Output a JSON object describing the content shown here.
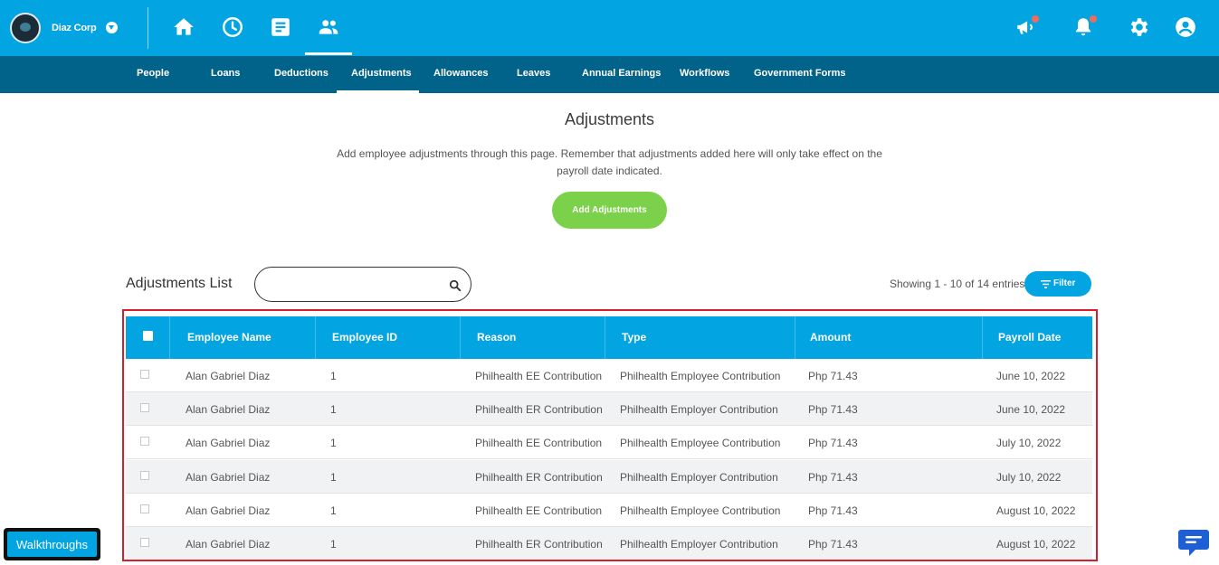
{
  "header": {
    "company": "Diaz Corp",
    "top_icons": [
      "home-icon",
      "clock-icon",
      "document-icon",
      "people-icon"
    ],
    "right_icons": [
      "megaphone-icon",
      "bell-icon",
      "gear-icon",
      "user-circle-icon"
    ]
  },
  "subnav": {
    "items": [
      "People",
      "Loans",
      "Deductions",
      "Adjustments",
      "Allowances",
      "Leaves",
      "Annual Earnings",
      "Workflows",
      "Government Forms"
    ],
    "active": "Adjustments"
  },
  "page": {
    "title": "Adjustments",
    "description": "Add employee adjustments through this page. Remember that adjustments added here will only take effect on the payroll date indicated.",
    "add_button": "Add Adjustments"
  },
  "list": {
    "title": "Adjustments List",
    "search_value": "",
    "showing": "Showing 1 - 10 of 14 entries",
    "filter_label": "Filter"
  },
  "table": {
    "headers": [
      "Employee Name",
      "Employee ID",
      "Reason",
      "Type",
      "Amount",
      "Payroll Date"
    ],
    "rows": [
      [
        "Alan Gabriel Diaz",
        "1",
        "Philhealth EE Contribution",
        "Philhealth Employee Contribution",
        "Php 71.43",
        "June 10, 2022"
      ],
      [
        "Alan Gabriel Diaz",
        "1",
        "Philhealth ER Contribution",
        "Philhealth Employer Contribution",
        "Php 71.43",
        "June 10, 2022"
      ],
      [
        "Alan Gabriel Diaz",
        "1",
        "Philhealth EE Contribution",
        "Philhealth Employee Contribution",
        "Php 71.43",
        "July 10, 2022"
      ],
      [
        "Alan Gabriel Diaz",
        "1",
        "Philhealth ER Contribution",
        "Philhealth Employer Contribution",
        "Php 71.43",
        "July 10, 2022"
      ],
      [
        "Alan Gabriel Diaz",
        "1",
        "Philhealth EE Contribution",
        "Philhealth Employee Contribution",
        "Php 71.43",
        "August 10, 2022"
      ],
      [
        "Alan Gabriel Diaz",
        "1",
        "Philhealth ER Contribution",
        "Philhealth Employer Contribution",
        "Php 71.43",
        "August 10, 2022"
      ]
    ]
  },
  "footer": {
    "walkthroughs": "Walkthroughs"
  },
  "colors": {
    "primary": "#03a4e2",
    "subnav": "#02638a",
    "add_button": "#7bd14a",
    "highlight_frame": "#d71f2b",
    "notification_dot": "#f06b5c"
  }
}
